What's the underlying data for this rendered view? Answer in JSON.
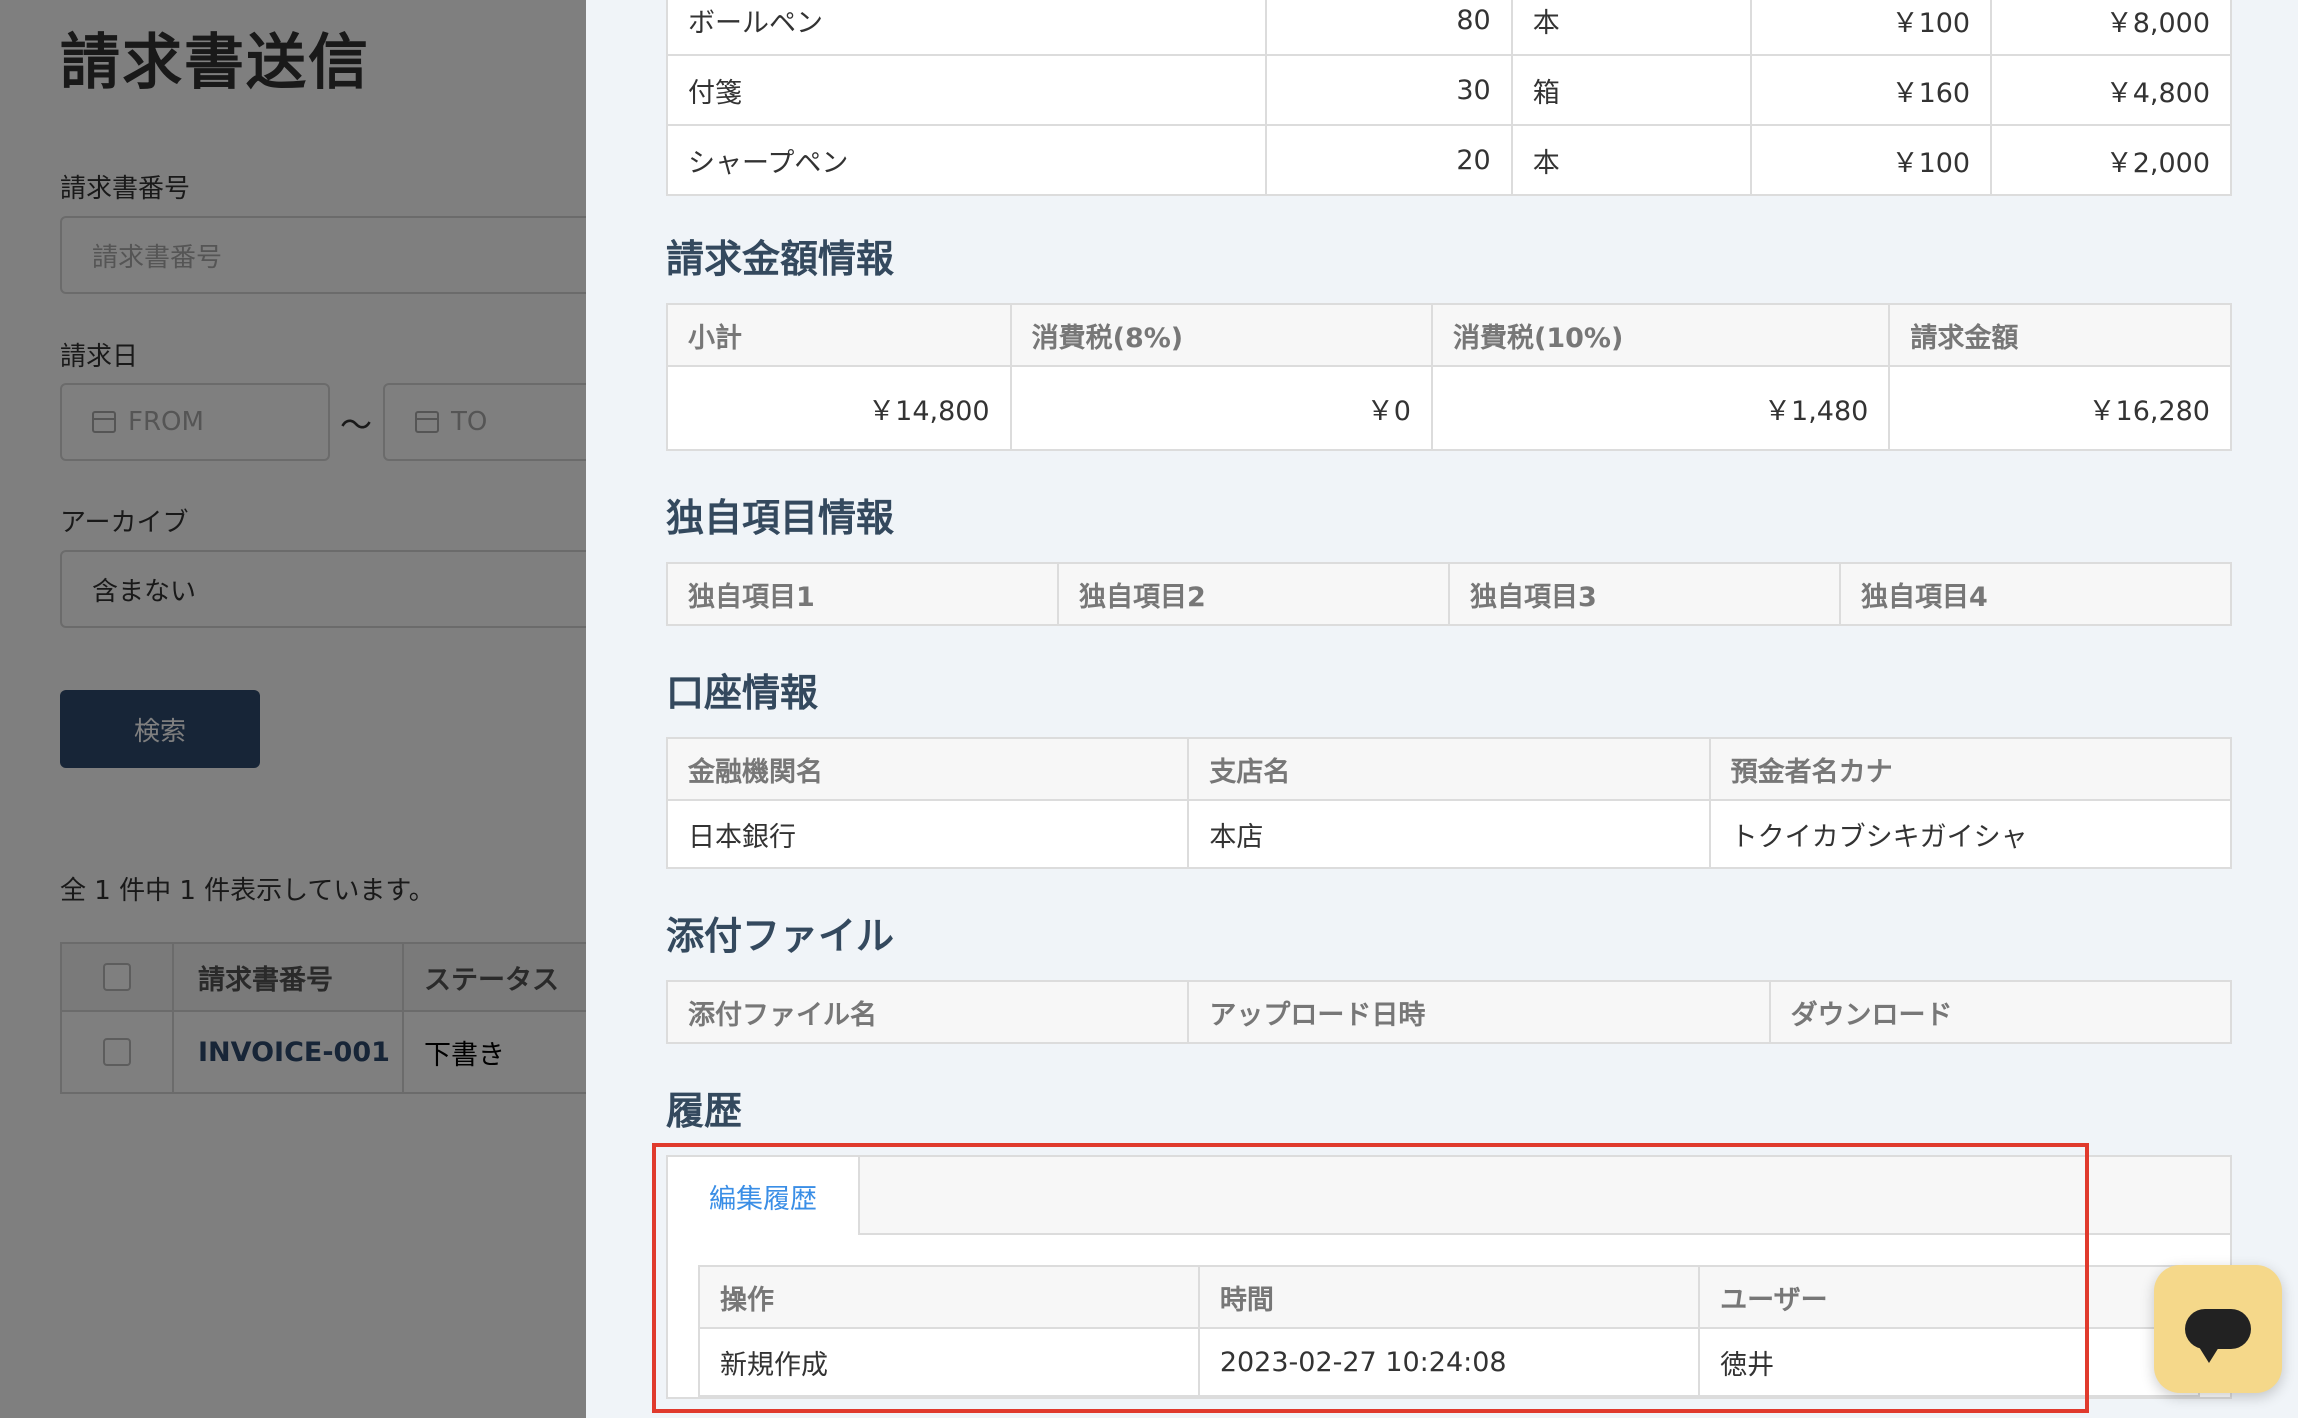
{
  "background": {
    "title": "請求書送信",
    "invoice_number_label": "請求書番号",
    "invoice_number_placeholder": "請求書番号",
    "invoice_date_label": "請求日",
    "date_from_placeholder": "FROM",
    "date_to_placeholder": "TO",
    "date_separator": "〜",
    "archive_label": "アーカイブ",
    "archive_value": "含まない",
    "search_button": "検索",
    "result_count": "全 1 件中 1 件表示しています。",
    "table": {
      "headers": [
        "請求書番号",
        "ステータス"
      ],
      "rows": [
        {
          "invoice": "INVOICE-001",
          "status": "下書き"
        }
      ]
    }
  },
  "items": [
    {
      "name": "ボールペン",
      "qty": "80",
      "unit": "本",
      "price": "￥100",
      "amount": "￥8,000"
    },
    {
      "name": "付箋",
      "qty": "30",
      "unit": "箱",
      "price": "￥160",
      "amount": "￥4,800"
    },
    {
      "name": "シャープペン",
      "qty": "20",
      "unit": "本",
      "price": "￥100",
      "amount": "￥2,000"
    }
  ],
  "billing": {
    "title": "請求金額情報",
    "headers": [
      "小計",
      "消費税(8%)",
      "消費税(10%)",
      "請求金額"
    ],
    "values": [
      "￥14,800",
      "￥0",
      "￥1,480",
      "￥16,280"
    ]
  },
  "custom": {
    "title": "独自項目情報",
    "headers": [
      "独自項目1",
      "独自項目2",
      "独自項目3",
      "独自項目4"
    ]
  },
  "bank": {
    "title": "口座情報",
    "headers": [
      "金融機関名",
      "支店名",
      "預金者名カナ"
    ],
    "values": [
      "日本銀行",
      "本店",
      "トクイカブシキガイシャ"
    ]
  },
  "attachments": {
    "title": "添付ファイル",
    "headers": [
      "添付ファイル名",
      "アップロード日時",
      "ダウンロード"
    ]
  },
  "history": {
    "title": "履歴",
    "tab_label": "編集履歴",
    "headers": [
      "操作",
      "時間",
      "ユーザー"
    ],
    "rows": [
      {
        "action": "新規作成",
        "time": "2023-02-27 10:24:08",
        "user": "徳井"
      }
    ]
  },
  "colors": {
    "accent": "#3a8ee6",
    "highlight": "#e03a2d",
    "primary_button": "#2e4a6f",
    "chat_button": "#f5d88a"
  },
  "icons": {
    "calendar": "calendar-icon",
    "chat": "chat-icon"
  }
}
